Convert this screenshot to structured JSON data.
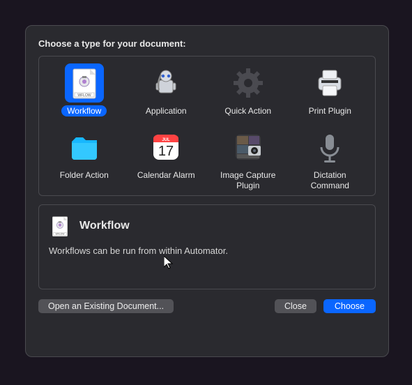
{
  "dialog": {
    "heading": "Choose a type for your document:",
    "types": [
      {
        "id": "workflow",
        "label": "Workflow",
        "selected": true
      },
      {
        "id": "application",
        "label": "Application",
        "selected": false
      },
      {
        "id": "quick-action",
        "label": "Quick Action",
        "selected": false
      },
      {
        "id": "print-plugin",
        "label": "Print Plugin",
        "selected": false
      },
      {
        "id": "folder-action",
        "label": "Folder Action",
        "selected": false
      },
      {
        "id": "calendar-alarm",
        "label": "Calendar Alarm",
        "selected": false
      },
      {
        "id": "image-capture-plugin",
        "label": "Image Capture Plugin",
        "selected": false
      },
      {
        "id": "dictation-command",
        "label": "Dictation Command",
        "selected": false
      }
    ],
    "calendar": {
      "month": "JUL",
      "day": "17"
    },
    "detail": {
      "title": "Workflow",
      "description": "Workflows can be run from within Automator."
    },
    "buttons": {
      "open_existing": "Open an Existing Document...",
      "close": "Close",
      "choose": "Choose"
    }
  }
}
